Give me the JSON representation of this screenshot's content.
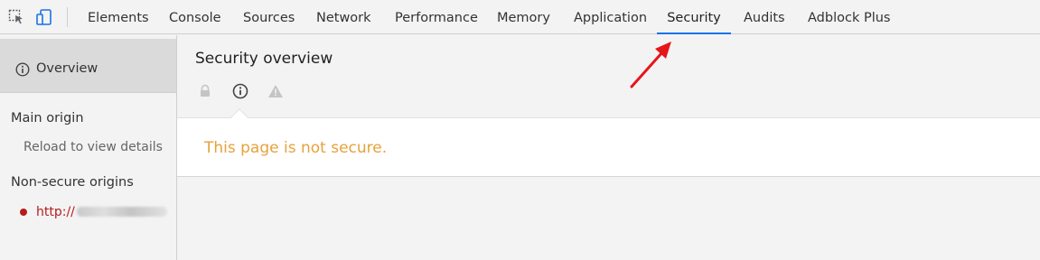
{
  "toolbar": {
    "inspect_icon": "inspect-element-icon",
    "device_icon": "device-toolbar-icon"
  },
  "tabs": [
    {
      "label": "Elements"
    },
    {
      "label": "Console"
    },
    {
      "label": "Sources"
    },
    {
      "label": "Network"
    },
    {
      "label": "Performance"
    },
    {
      "label": "Memory"
    },
    {
      "label": "Application"
    },
    {
      "label": "Security",
      "active": true
    },
    {
      "label": "Audits"
    },
    {
      "label": "Adblock Plus"
    }
  ],
  "sidebar": {
    "overview_label": "Overview",
    "main_origin_heading": "Main origin",
    "reload_text": "Reload to view details",
    "nonsecure_heading": "Non-secure origins",
    "origin_prefix": "http://"
  },
  "main": {
    "title": "Security overview",
    "summary_text": "This page is not secure."
  },
  "colors": {
    "accent": "#1a73e8",
    "warning_text": "#e6a23c",
    "nonsecure": "#b71c1c",
    "annotation_arrow": "#e5161b"
  }
}
